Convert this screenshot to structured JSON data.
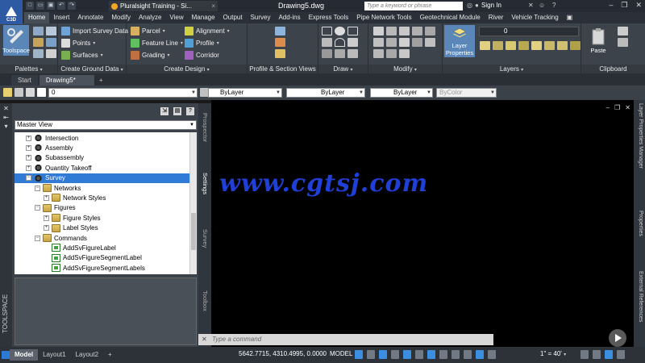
{
  "app": {
    "logo_text": "C3D",
    "document_title": "Drawing5.dwg",
    "search_placeholder": "Type a keyword or phrase",
    "sign_in": "Sign In",
    "browser_tab": "Pluralsight Training - Si..."
  },
  "ribbon_tabs": [
    "Home",
    "Insert",
    "Annotate",
    "Modify",
    "Analyze",
    "View",
    "Manage",
    "Output",
    "Survey",
    "Add-ins",
    "Express Tools",
    "Pipe Network Tools",
    "Geotechnical Module",
    "River",
    "Vehicle Tracking"
  ],
  "active_ribbon_tab": "Home",
  "ribbon": {
    "toolspace_label": "Toolspace",
    "palettes_label": "Palettes",
    "ground_data": {
      "items": [
        "Import Survey Data",
        "Points",
        "Surfaces"
      ],
      "label": "Create Ground Data"
    },
    "design": {
      "col1": [
        "Parcel",
        "Feature Line",
        "Grading"
      ],
      "col2": [
        "Alignment",
        "Profile",
        "Corridor"
      ],
      "label": "Create Design"
    },
    "profile_label": "Profile & Section Views",
    "draw_label": "Draw",
    "modify_label": "Modify",
    "layer_properties_label": "Layer\nProperties",
    "layer_value": "0",
    "layers_label": "Layers",
    "paste_label": "Paste",
    "clipboard_label": "Clipboard"
  },
  "file_tabs": [
    "Start",
    "Drawing5*"
  ],
  "active_file_tab": "Drawing5*",
  "properties_bar": {
    "layer": "0",
    "color": "ByLayer",
    "linetype": "ByLayer",
    "lineweight": "ByLayer",
    "plotstyle": "ByColor"
  },
  "toolspace": {
    "vertical_label": "TOOLSPACE",
    "view_selector": "Master View",
    "tree": [
      {
        "label": "Intersection",
        "indent": 0,
        "expander": "+",
        "icon": "gear"
      },
      {
        "label": "Assembly",
        "indent": 0,
        "expander": "+",
        "icon": "gear"
      },
      {
        "label": "Subassembly",
        "indent": 0,
        "expander": "+",
        "icon": "gear"
      },
      {
        "label": "Quantity Takeoff",
        "indent": 0,
        "expander": "+",
        "icon": "gear"
      },
      {
        "label": "Survey",
        "indent": 0,
        "expander": "-",
        "icon": "gear",
        "selected": true
      },
      {
        "label": "Networks",
        "indent": 1,
        "expander": "-",
        "icon": "folder"
      },
      {
        "label": "Network Styles",
        "indent": 2,
        "expander": "+",
        "icon": "folder"
      },
      {
        "label": "Figures",
        "indent": 1,
        "expander": "-",
        "icon": "folder"
      },
      {
        "label": "Figure Styles",
        "indent": 2,
        "expander": "+",
        "icon": "folder"
      },
      {
        "label": "Label Styles",
        "indent": 2,
        "expander": "+",
        "icon": "folder"
      },
      {
        "label": "Commands",
        "indent": 1,
        "expander": "-",
        "icon": "folder"
      },
      {
        "label": "AddSvFigureLabel",
        "indent": 2,
        "expander": "",
        "icon": "cmd"
      },
      {
        "label": "AddSvFigureSegmentLabel",
        "indent": 2,
        "expander": "",
        "icon": "cmd"
      },
      {
        "label": "AddSvFigureSegmentLabels",
        "indent": 2,
        "expander": "",
        "icon": "cmd"
      }
    ],
    "side_tabs": [
      "Prospector",
      "Settings",
      "Survey",
      "Toolbox"
    ],
    "active_side_tab": "Settings"
  },
  "drawing": {
    "watermark": "www.cgtsj.com",
    "command_prompt": "Type a command"
  },
  "right_palettes": [
    "Layer Properties Manager",
    "Properties",
    "External References"
  ],
  "status": {
    "layout_tabs": [
      "Model",
      "Layout1",
      "Layout2"
    ],
    "active_layout": "Model",
    "coordinates": "5642.7715, 4310.4995, 0.0000",
    "model_space": "MODEL",
    "scale": "1\" = 40'"
  }
}
